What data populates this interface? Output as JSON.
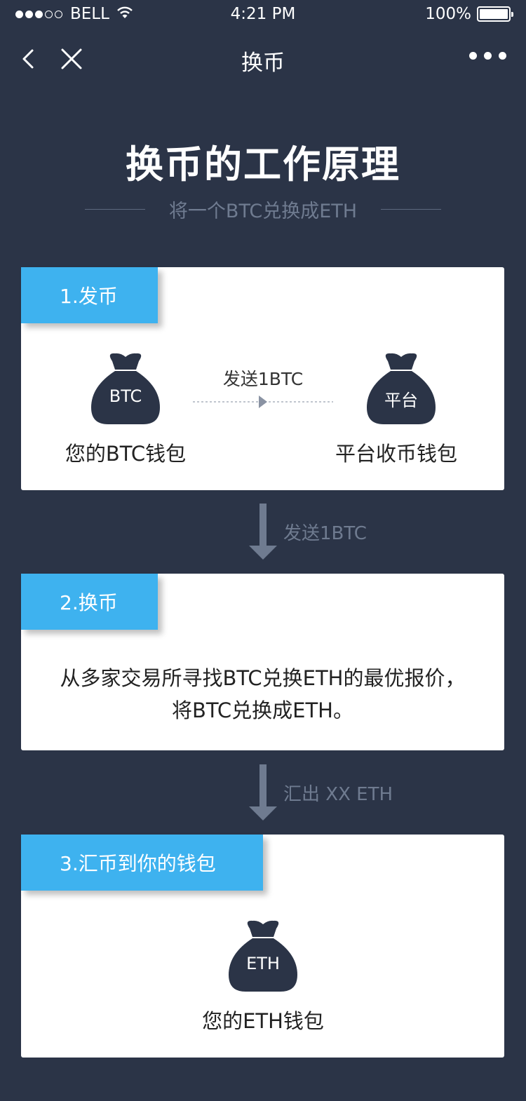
{
  "status_bar": {
    "carrier": "BELL",
    "time": "4:21 PM",
    "battery": "100%",
    "signal_bars_filled": 3,
    "signal_bars_total": 5
  },
  "nav": {
    "title": "换币",
    "back_icon": "chevron-left-icon",
    "close_icon": "close-icon",
    "more_icon": "more-horizontal-icon"
  },
  "heading": {
    "title": "换币的工作原理",
    "subtitle": "将一个BTC兑换成ETH"
  },
  "steps": [
    {
      "label": "1.发币",
      "from_bag": "BTC",
      "from_caption": "您的BTC钱包",
      "transfer_label": "发送1BTC",
      "to_bag": "平台",
      "to_caption": "平台收币钱包"
    },
    {
      "label": "2.换币",
      "text_line1": "从多家交易所寻找BTC兑换ETH的最优报价，",
      "text_line2": "将BTC兑换成ETH。"
    },
    {
      "label": "3.汇币到你的钱包",
      "bag": "ETH",
      "caption": "您的ETH钱包"
    }
  ],
  "flow_labels": [
    "发送1BTC",
    "汇出 XX ETH"
  ],
  "colors": {
    "background": "#2b3447",
    "accent": "#3eb2ef",
    "bag": "#2b3447",
    "muted": "#6f7b90"
  }
}
